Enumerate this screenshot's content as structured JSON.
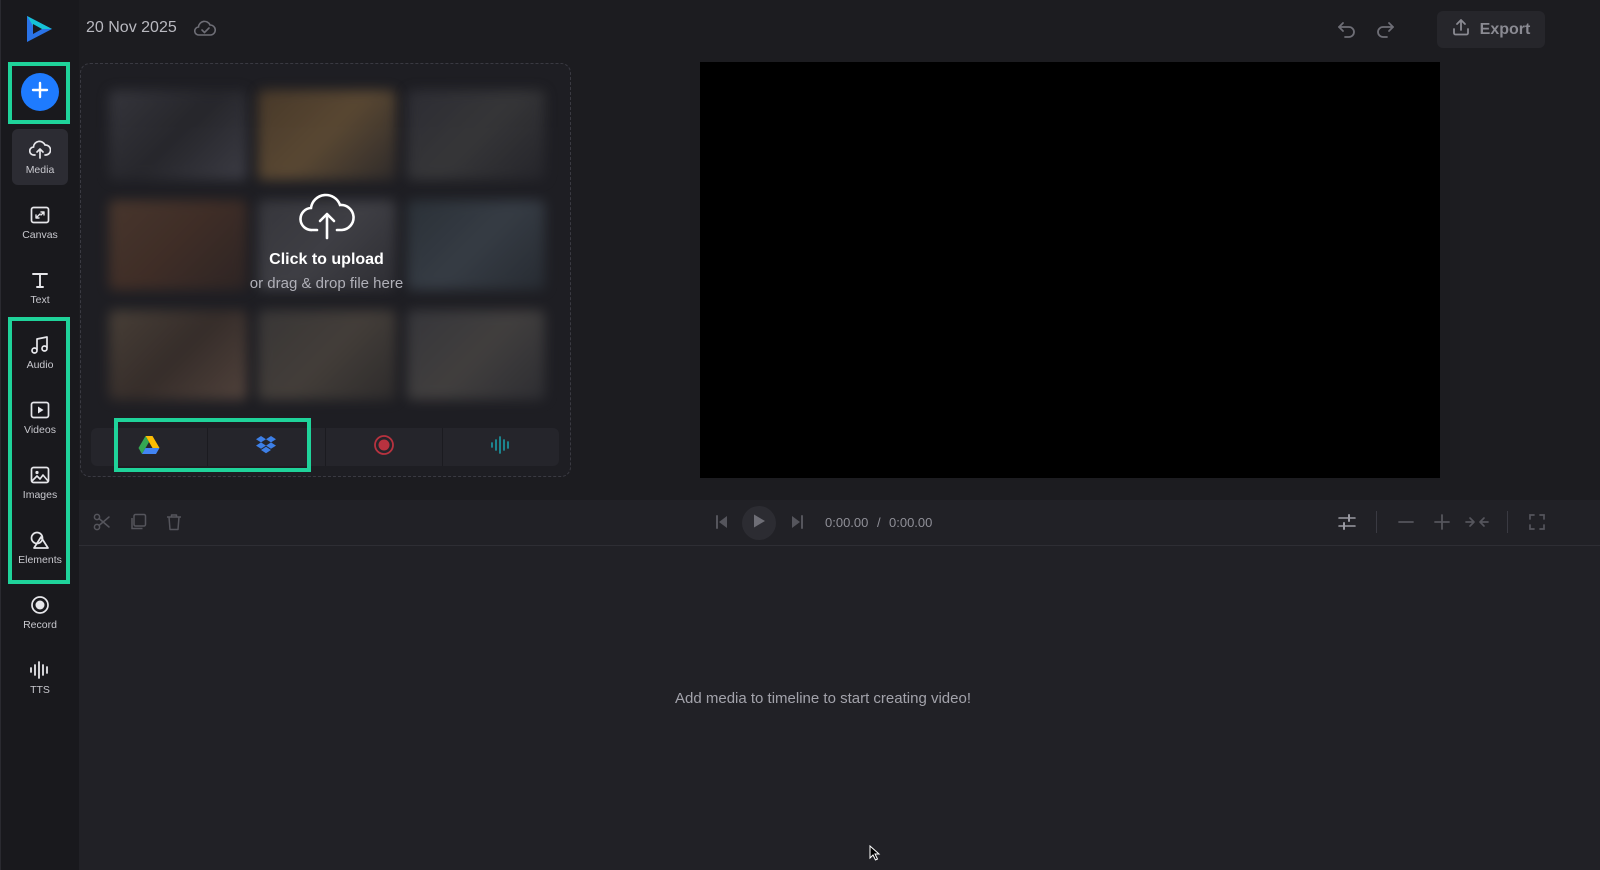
{
  "app": {
    "logo": "play-triangle-logo",
    "brand_colors": {
      "accent": "#1e7bff",
      "highlight": "#1fd39a",
      "logo_teal": "#16c2d5",
      "logo_blue": "#2a73e8"
    }
  },
  "header": {
    "date": "20 Nov 2025",
    "sync_icon": "cloud-check-icon",
    "export_label": "Export"
  },
  "sidebar": {
    "add_icon": "plus-icon",
    "items": [
      {
        "label": "Media",
        "icon": "upload-cloud-icon",
        "active": true
      },
      {
        "label": "Canvas",
        "icon": "canvas-icon"
      },
      {
        "label": "Text",
        "icon": "text-icon"
      },
      {
        "label": "Audio",
        "icon": "music-icon"
      },
      {
        "label": "Videos",
        "icon": "video-icon"
      },
      {
        "label": "Images",
        "icon": "image-icon"
      },
      {
        "label": "Elements",
        "icon": "shapes-icon"
      },
      {
        "label": "Record",
        "icon": "record-icon"
      },
      {
        "label": "TTS",
        "icon": "waveform-icon"
      }
    ]
  },
  "upload": {
    "title": "Click to upload",
    "subtitle": "or drag & drop file here",
    "sources": [
      {
        "name": "google-drive",
        "icon": "google-drive-icon"
      },
      {
        "name": "dropbox",
        "icon": "dropbox-icon"
      },
      {
        "name": "record",
        "icon": "record-dot-icon"
      },
      {
        "name": "tts",
        "icon": "waveform-icon"
      }
    ]
  },
  "timeline": {
    "current_time": "0:00.00",
    "separator": "/",
    "total_time": "0:00.00",
    "empty_message": "Add media to timeline to start creating video!"
  }
}
